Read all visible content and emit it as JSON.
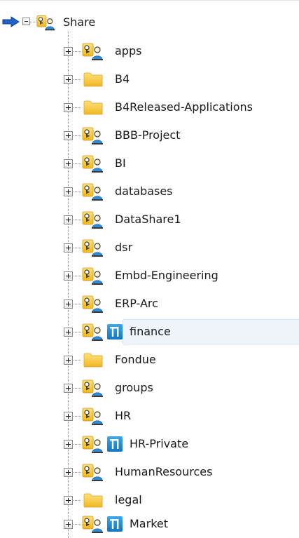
{
  "tree": {
    "root": {
      "label": "Share",
      "icon": "shared-folder-icon",
      "expanded": true
    },
    "items": [
      {
        "label": "apps",
        "icon": "shared-folder-icon",
        "dfs": false
      },
      {
        "label": "B4",
        "icon": "folder-icon",
        "dfs": false
      },
      {
        "label": "B4Released-Applications",
        "icon": "folder-icon",
        "dfs": false
      },
      {
        "label": "BBB-Project",
        "icon": "shared-folder-icon",
        "dfs": false
      },
      {
        "label": "BI",
        "icon": "shared-folder-icon",
        "dfs": false
      },
      {
        "label": "databases",
        "icon": "shared-folder-icon",
        "dfs": false
      },
      {
        "label": "DataShare1",
        "icon": "shared-folder-icon",
        "dfs": false
      },
      {
        "label": "dsr",
        "icon": "shared-folder-icon",
        "dfs": false
      },
      {
        "label": "Embd-Engineering",
        "icon": "shared-folder-icon",
        "dfs": false
      },
      {
        "label": "ERP-Arc",
        "icon": "shared-folder-icon",
        "dfs": false
      },
      {
        "label": "finance",
        "icon": "shared-folder-icon",
        "dfs": true,
        "selected": true
      },
      {
        "label": "Fondue",
        "icon": "folder-icon",
        "dfs": false
      },
      {
        "label": "groups",
        "icon": "shared-folder-icon",
        "dfs": false
      },
      {
        "label": "HR",
        "icon": "shared-folder-icon",
        "dfs": false
      },
      {
        "label": "HR-Private",
        "icon": "shared-folder-icon",
        "dfs": true
      },
      {
        "label": "HumanResources",
        "icon": "shared-folder-icon",
        "dfs": false
      },
      {
        "label": "legal",
        "icon": "folder-icon",
        "dfs": false
      },
      {
        "label": "Market",
        "icon": "shared-folder-icon",
        "dfs": true
      }
    ]
  },
  "colors": {
    "selection_bg": "#eef5fb",
    "folder": "#f5c542",
    "dfs_badge": "#1f8ad2",
    "arrow": "#1e63c8"
  }
}
